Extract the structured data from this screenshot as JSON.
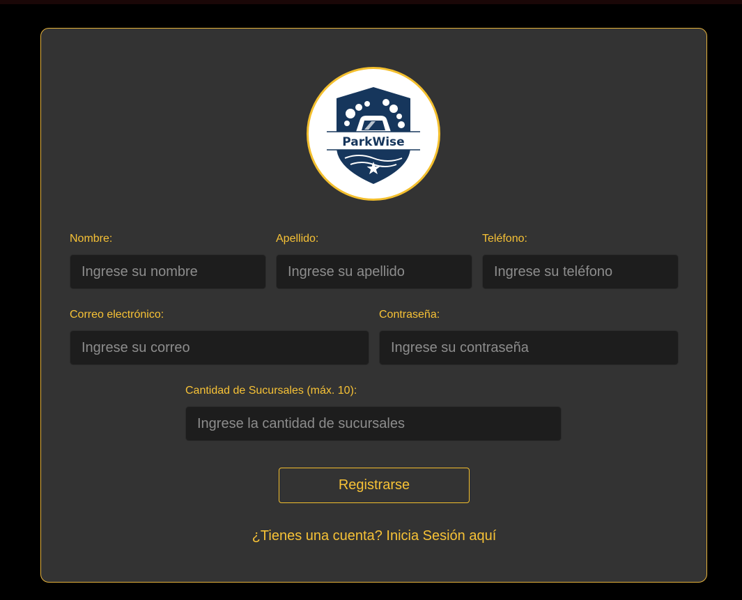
{
  "logo": {
    "brand_text": "ParkWise",
    "icon": "car-shield-logo-icon"
  },
  "form": {
    "nombre": {
      "label": "Nombre:",
      "placeholder": "Ingrese su nombre",
      "value": ""
    },
    "apellido": {
      "label": "Apellido:",
      "placeholder": "Ingrese su apellido",
      "value": ""
    },
    "telefono": {
      "label": "Teléfono:",
      "placeholder": "Ingrese su teléfono",
      "value": ""
    },
    "correo": {
      "label": "Correo electrónico:",
      "placeholder": "Ingrese su correo",
      "value": ""
    },
    "contrasena": {
      "label": "Contraseña:",
      "placeholder": "Ingrese su contraseña",
      "value": ""
    },
    "sucursales": {
      "label": "Cantidad de Sucursales (máx. 10):",
      "placeholder": "Ingrese la cantidad de sucursales",
      "value": ""
    },
    "submit_label": "Registrarse",
    "login_link": "¿Tienes una cuenta? Inicia Sesión aquí"
  },
  "colors": {
    "page_background": "#000000",
    "card_background": "#333333",
    "accent": "#f7c236",
    "input_background": "#1d1d1d",
    "placeholder": "#8d8d8d",
    "logo_navy": "#16365c"
  }
}
